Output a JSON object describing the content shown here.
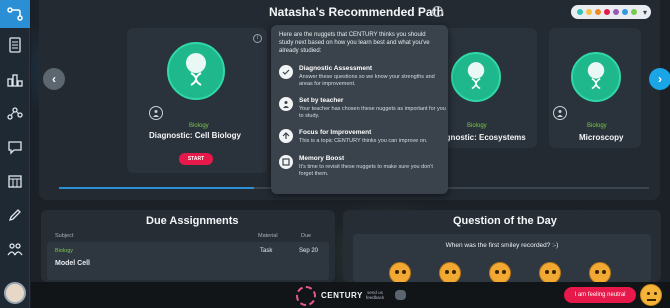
{
  "sidebar": {
    "items": [
      {
        "name": "path-icon"
      },
      {
        "name": "notes-icon"
      },
      {
        "name": "podium-icon"
      },
      {
        "name": "graph-icon"
      },
      {
        "name": "chat-icon"
      },
      {
        "name": "calendar-icon"
      },
      {
        "name": "pencil-icon"
      },
      {
        "name": "group-icon"
      }
    ]
  },
  "path": {
    "title": "Natasha's Recommended Path",
    "cards": [
      {
        "tag": "Biology",
        "title": "Diagnostic: Cell Biology",
        "start_label": "START"
      },
      {
        "tag": "Biology",
        "title": "iagnostic: Ecosystems"
      },
      {
        "tag": "Biology",
        "title": "Microscopy"
      }
    ],
    "progress": 0.33,
    "dots": [
      "#2ec4b6",
      "#f6c243",
      "#f08a24",
      "#e6194a",
      "#9b59b6",
      "#3498db",
      "#7ac94f"
    ]
  },
  "tooltip": {
    "intro": "Here are the nuggets that CENTURY thinks you should study next based on how you learn best and what you've already studied:",
    "items": [
      {
        "title": "Diagnostic Assessment",
        "desc": "Answer these questions so we know your strengths and areas for improvement."
      },
      {
        "title": "Set by teacher",
        "desc": "Your teacher has chosen these nuggets as important for you to study."
      },
      {
        "title": "Focus for Improvement",
        "desc": "This is a topic CENTURY thinks you can improve on."
      },
      {
        "title": "Memory Boost",
        "desc": "It's time to revisit these nuggets to make sure you don't forget them."
      }
    ]
  },
  "assignments": {
    "title": "Due Assignments",
    "headers": {
      "subject": "Subject",
      "material": "Material",
      "due": "Due"
    },
    "rows": [
      {
        "subject": "Biology",
        "name": "Model Cell",
        "material": "Task",
        "due": "Sep 20"
      }
    ]
  },
  "qotd": {
    "title": "Question of the Day",
    "question": "When was the first smiley recorded? :-)"
  },
  "footer": {
    "logo": "CENTURY",
    "feedback": "send us feedback",
    "mood_label": "I am feeling neutral"
  },
  "colors": {
    "accent": "#2b8fd6",
    "brand_red": "#e6194a",
    "biology_green": "#1fb88d"
  }
}
